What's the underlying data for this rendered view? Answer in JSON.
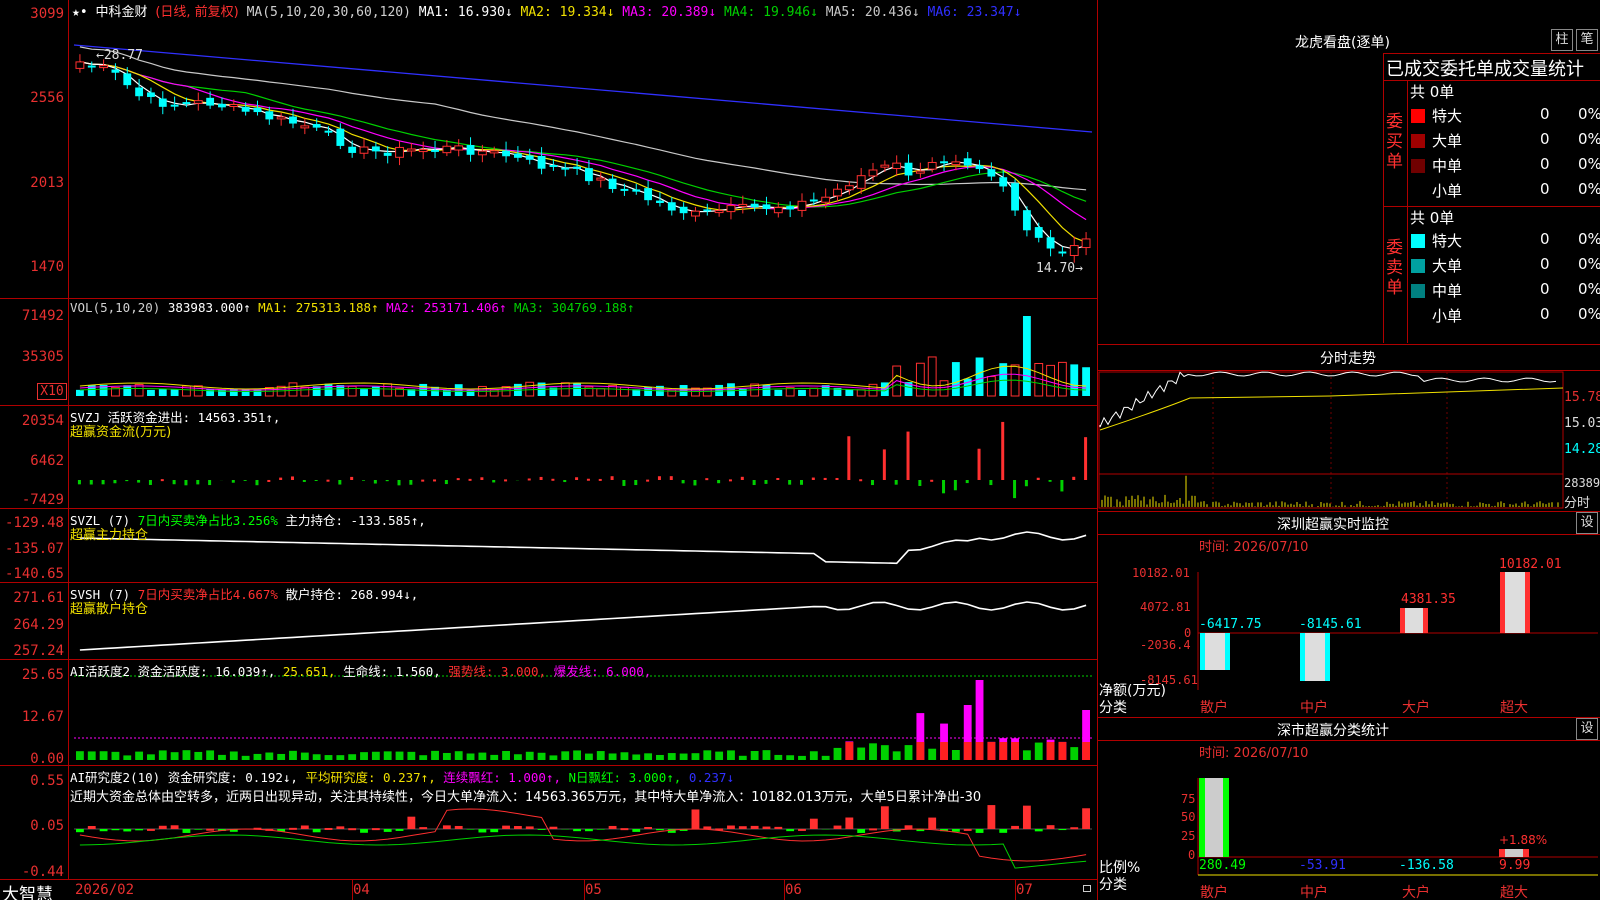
{
  "app": {
    "name": "大智慧",
    "star": "★•",
    "stock": "中科金财",
    "mode": "(日线, 前复权)"
  },
  "price_panel": {
    "ma_line": [
      {
        "text": "MA(5,10,20,30,60,120)",
        "color": "#d0d0d0"
      },
      {
        "text": "MA1: 16.930↓",
        "color": "#ffffff"
      },
      {
        "text": "MA2: 19.334↓",
        "color": "#f0e000"
      },
      {
        "text": "MA3: 20.389↓",
        "color": "#ff00ff"
      },
      {
        "text": "MA4: 19.946↓",
        "color": "#00d000"
      },
      {
        "text": "MA5: 20.436↓",
        "color": "#c8c8c8"
      },
      {
        "text": "MA6: 23.347↓",
        "color": "#3030ff"
      }
    ],
    "y_labels": [
      "3099",
      "2556",
      "2013",
      "1470"
    ],
    "high_label": "←28.77",
    "low_label": "14.70→"
  },
  "vol_panel": {
    "title": [
      {
        "text": "VOL(5,10,20)",
        "color": "#d0d0d0"
      },
      {
        "text": "383983.000↑",
        "color": "#ffffff"
      },
      {
        "text": "MA1: 275313.188↑",
        "color": "#f0e000"
      },
      {
        "text": "MA2: 253171.406↑",
        "color": "#ff00ff"
      },
      {
        "text": "MA3: 304769.188↑",
        "color": "#00d000"
      }
    ],
    "y_labels": [
      "71492",
      "35305"
    ],
    "multiplier": "X10"
  },
  "svzj_panel": {
    "title1": "SVZJ  活跃资金进出: 14563.351↑,",
    "title2": "超赢资金流(万元)",
    "y_labels": [
      "20354",
      "6462",
      "-7429"
    ]
  },
  "svzl_panel": {
    "t_a": "SVZL (7)",
    "t_b": "7日内买卖净占比3.256%",
    "t_c": "主力持仓: -133.585↑,",
    "title2": "超赢主力持仓",
    "y_labels": [
      "-129.48",
      "-135.07",
      "-140.65"
    ]
  },
  "svsh_panel": {
    "t_a": "SVSH (7)",
    "t_b": "7日内买卖净占比4.667%",
    "t_c": "散户持仓: 268.994↓,",
    "title2": "超赢散户持仓",
    "y_labels": [
      "271.61",
      "264.29",
      "257.24"
    ]
  },
  "ai_active_panel": {
    "title": [
      {
        "text": "AI活跃度2",
        "color": "#ffffff"
      },
      {
        "text": "资金活跃度: 16.039↑,",
        "color": "#ffffff"
      },
      {
        "text": "25.651,",
        "color": "#f0e000"
      },
      {
        "text": "生命线: 1.560,",
        "color": "#ffffff"
      },
      {
        "text": "强势线: 3.000,",
        "color": "#ff3030"
      },
      {
        "text": "爆发线: 6.000,",
        "color": "#ff00ff"
      }
    ],
    "y_labels": [
      "25.65",
      "12.67",
      "0.00"
    ]
  },
  "ai_research_panel": {
    "title": [
      {
        "text": "AI研究度2(10)",
        "color": "#ffffff"
      },
      {
        "text": "资金研究度: 0.192↓,",
        "color": "#ffffff"
      },
      {
        "text": "平均研究度: 0.237↑,",
        "color": "#f0e000"
      },
      {
        "text": "连续飘红: 1.000↑,",
        "color": "#ff00ff"
      },
      {
        "text": "N日飘红: 3.000↑,",
        "color": "#00ff00"
      },
      {
        "text": "0.237↓",
        "color": "#3030ff"
      }
    ],
    "comment": "近期大资金总体由空转多，近两日出现异动，关注其持续性，今日大单净流入：14563.365万元，其中特大单净流入：10182.013万元，大单5日累计净出-30",
    "y_labels": [
      "0.55",
      "0.05",
      "-0.44"
    ]
  },
  "x_axis": [
    "2026/02",
    "04",
    "05",
    "06",
    "07"
  ],
  "longhu": {
    "title": "龙虎看盘(逐单)",
    "btn_bar": "柱",
    "btn_pen": "笔",
    "header": "已成交委托单成交量统计",
    "buy": {
      "side_label": "委买单",
      "total": "共 0单",
      "rows": [
        {
          "name": "特大",
          "count": "0",
          "pct": "0%",
          "color": "#ff0000"
        },
        {
          "name": "大单",
          "count": "0",
          "pct": "0%",
          "color": "#a00000"
        },
        {
          "name": "中单",
          "count": "0",
          "pct": "0%",
          "color": "#700000"
        },
        {
          "name": "小单",
          "count": "0",
          "pct": "0%",
          "color": "#000000"
        }
      ]
    },
    "sell": {
      "side_label": "委卖单",
      "total": "共 0单",
      "rows": [
        {
          "name": "特大",
          "count": "0",
          "pct": "0%",
          "color": "#00ffff"
        },
        {
          "name": "大单",
          "count": "0",
          "pct": "0%",
          "color": "#00a0a0"
        },
        {
          "name": "中单",
          "count": "0",
          "pct": "0%",
          "color": "#008080"
        },
        {
          "name": "小单",
          "count": "0",
          "pct": "0%",
          "color": "#000000"
        }
      ]
    }
  },
  "intraday": {
    "title": "分时走势",
    "p1": "15.78",
    "p2": "15.03",
    "p3": "14.28",
    "vol": "28389",
    "unit": "分时"
  },
  "sz_monitor": {
    "title": "深圳超赢实时监控",
    "btn": "设",
    "date": "时间: 2026/07/10",
    "y_labels": [
      "10182.01",
      "4072.81",
      "0",
      "-2036.4",
      "-8145.61"
    ],
    "values": [
      "-6417.75",
      "-8145.61",
      "4381.35",
      "10182.01"
    ],
    "cats": [
      "散户",
      "中户",
      "大户",
      "超大"
    ],
    "ylabel": "净额(万元)",
    "xlabel": "分类"
  },
  "sz_stats": {
    "title": "深市超赢分类统计",
    "btn": "设",
    "date": "时间: 2026/07/10",
    "y_labels": [
      "75",
      "50",
      "25",
      "0"
    ],
    "values": [
      "280.49",
      "-53.91",
      "-136.58",
      "9.99"
    ],
    "bar_note": "+1.88%",
    "cats": [
      "散户",
      "中户",
      "大户",
      "超大"
    ],
    "ylabel": "比例%",
    "xlabel": "分类"
  }
}
